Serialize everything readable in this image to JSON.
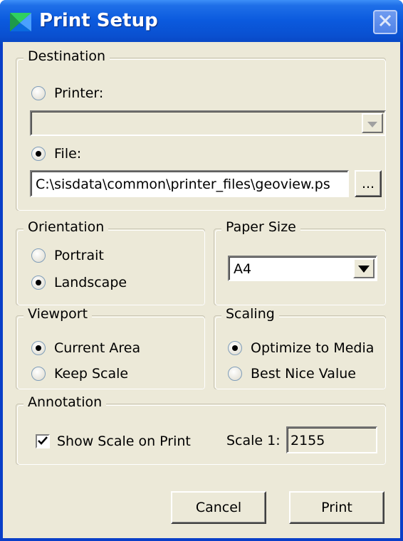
{
  "window": {
    "title": "Print Setup"
  },
  "destination": {
    "legend": "Destination",
    "printer_label": "Printer:",
    "printer_value": "",
    "file_label": "File:",
    "file_value": "C:\\sisdata\\common\\printer_files\\geoview.ps",
    "browse_label": "...",
    "selected": "file"
  },
  "orientation": {
    "legend": "Orientation",
    "portrait_label": "Portrait",
    "landscape_label": "Landscape",
    "selected": "landscape"
  },
  "paper_size": {
    "legend": "Paper Size",
    "value": "A4"
  },
  "viewport": {
    "legend": "Viewport",
    "current_area_label": "Current Area",
    "keep_scale_label": "Keep Scale",
    "selected": "current_area"
  },
  "scaling": {
    "legend": "Scaling",
    "optimize_label": "Optimize to Media",
    "best_nice_label": "Best Nice Value",
    "selected": "optimize"
  },
  "annotation": {
    "legend": "Annotation",
    "show_scale_label": "Show Scale on Print",
    "show_scale_checked": true,
    "scale_label": "Scale 1:",
    "scale_value": "2155"
  },
  "buttons": {
    "cancel_label": "Cancel",
    "print_label": "Print"
  },
  "icons": {
    "app": "app-icon",
    "close": "close-icon",
    "dropdown": "dropdown-arrow-icon",
    "check": "check-icon"
  }
}
